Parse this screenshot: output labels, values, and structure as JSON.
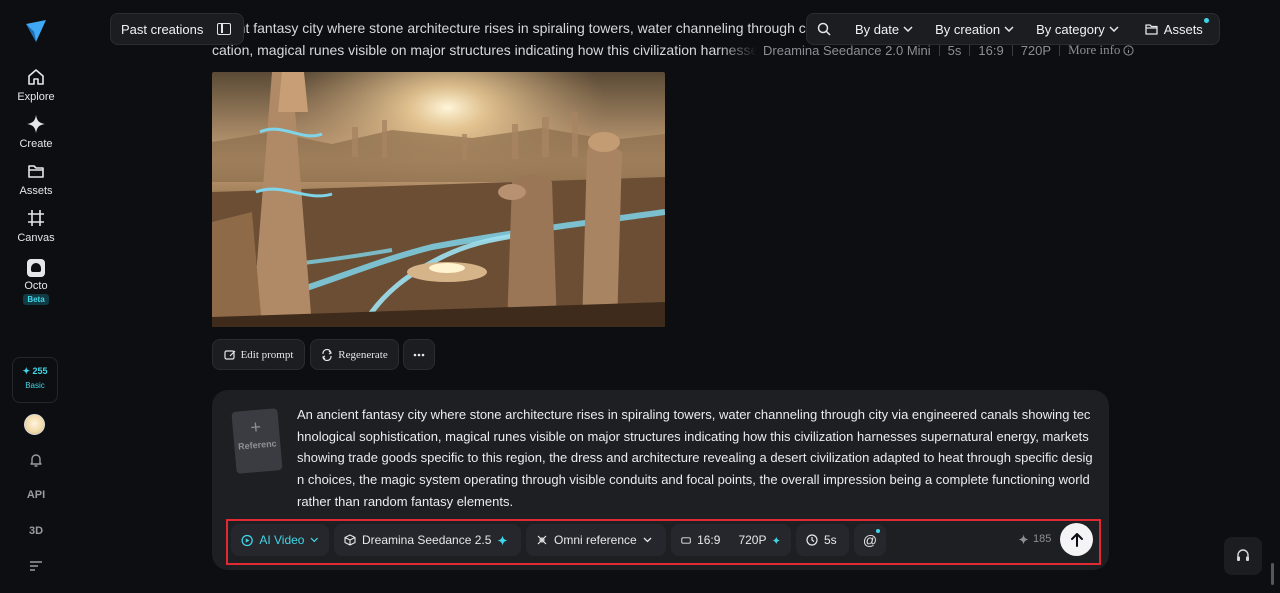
{
  "sidebar": {
    "items": [
      {
        "label": "Explore",
        "icon": "home-icon"
      },
      {
        "label": "Create",
        "icon": "sparkle-icon"
      },
      {
        "label": "Assets",
        "icon": "folder-icon"
      },
      {
        "label": "Canvas",
        "icon": "canvas-icon"
      },
      {
        "label": "Octo",
        "icon": "octo-icon",
        "badge": "Beta"
      }
    ],
    "credits": "255",
    "plan": "Basic",
    "api_label": "API",
    "three_d_label": "3D"
  },
  "header": {
    "past_creations": "Past creations",
    "filters": [
      "By date",
      "By creation",
      "By category"
    ],
    "assets_label": "Assets"
  },
  "generation": {
    "prompt_line1": "ncient fantasy city where stone architecture rises in spiraling towers, water channeling through city",
    "prompt_line2": "cation, magical runes visible on major structures indicating how this civilization harnesses sup",
    "model": "Dreamina Seedance 2.0 Mini",
    "duration": "5s",
    "ratio": "16:9",
    "resolution": "720P",
    "more_info": "More info",
    "actions": {
      "edit": "Edit prompt",
      "regenerate": "Regenerate"
    }
  },
  "composer": {
    "reference_label": "Referenc",
    "prompt": "An ancient fantasy city where stone architecture rises in spiraling towers, water channeling through city via engineered canals showing technological sophistication, magical runes visible on major structures indicating how this civilization harnesses supernatural energy, markets showing trade goods specific to this region, the dress and architecture revealing a desert civilization adapted to heat through specific design choices, the magic system operating through visible conduits and focal points, the overall impression being a complete functioning world rather than random fantasy elements.",
    "mode": "AI Video",
    "model": "Dreamina Seedance 2.5",
    "reference_mode": "Omni reference",
    "ratio": "16:9",
    "resolution": "720P",
    "duration": "5s",
    "mention": "@",
    "cost": "185"
  },
  "colors": {
    "accent": "#3fd6e8",
    "highlight": "#e02932",
    "background": "#0d0e11"
  }
}
